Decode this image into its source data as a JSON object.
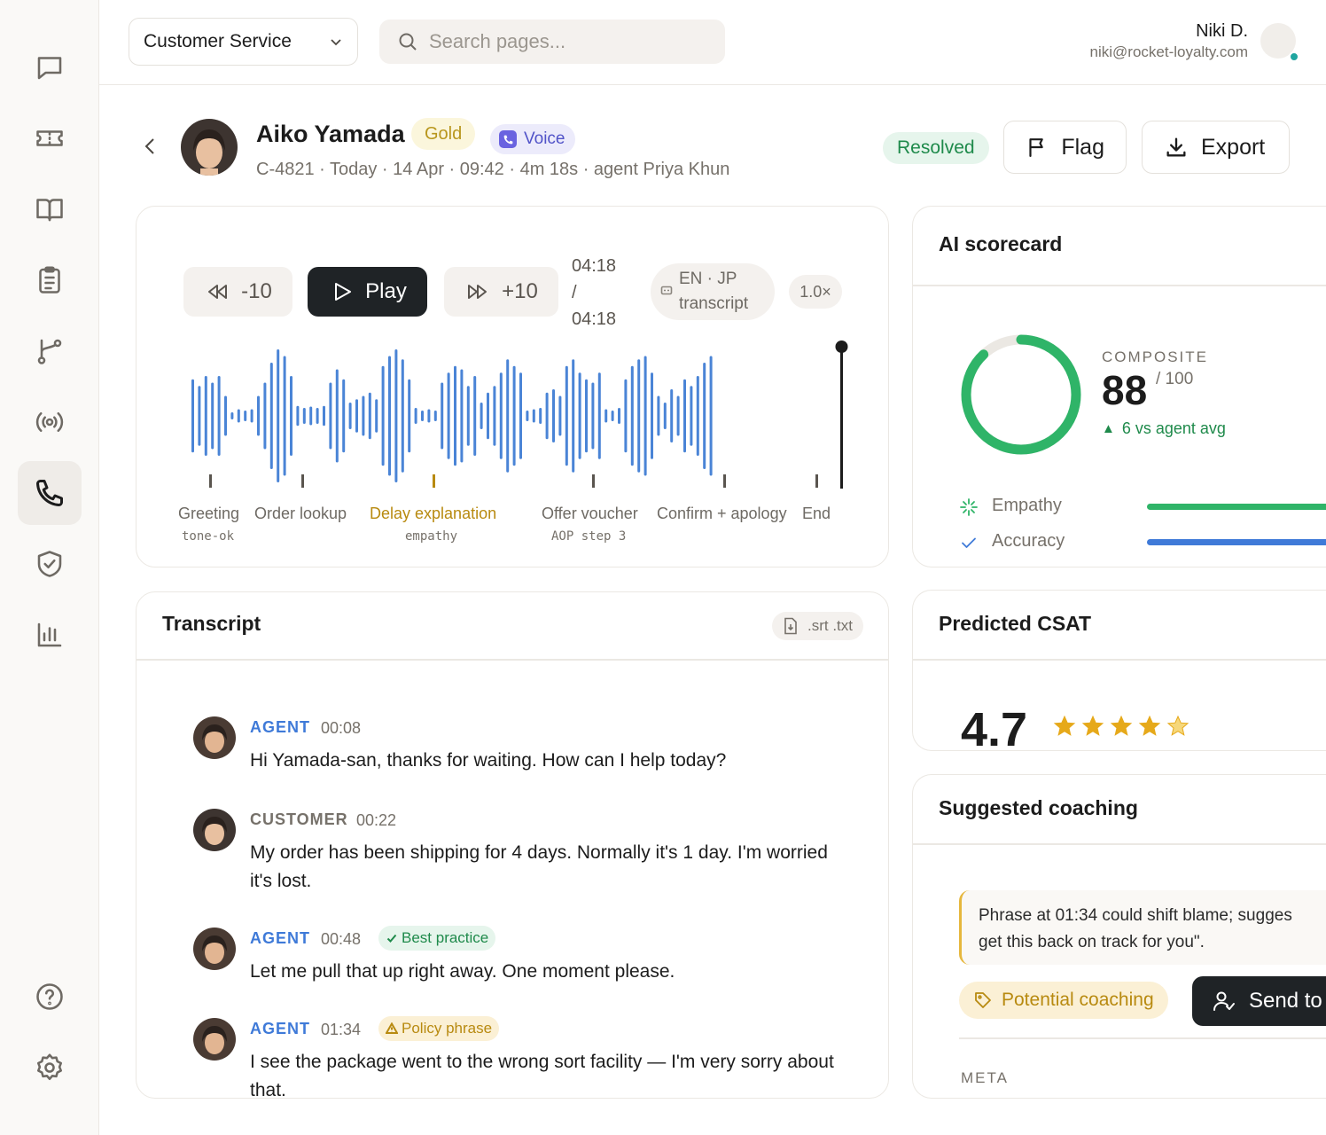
{
  "topbar": {
    "workspace": "Customer Service",
    "search_placeholder": "Search pages...",
    "user_name": "Niki D.",
    "user_email": "niki@rocket-loyalty.com"
  },
  "sidebar": {
    "items": [
      {
        "icon": "message-icon"
      },
      {
        "icon": "ticket-icon"
      },
      {
        "icon": "book-icon"
      },
      {
        "icon": "clipboard-icon"
      },
      {
        "icon": "branch-icon"
      },
      {
        "icon": "broadcast-icon"
      },
      {
        "icon": "phone-icon",
        "active": true
      },
      {
        "icon": "shield-check-icon"
      },
      {
        "icon": "bar-chart-icon"
      },
      {
        "icon": "help-icon"
      },
      {
        "icon": "gear-icon"
      }
    ]
  },
  "header": {
    "customer_name": "Aiko Yamada",
    "tier_badge": "Gold",
    "channel_badge": "Voice",
    "meta": "C-4821 · Today · 14 Apr · 09:42 · 4m 18s · agent Priya Khun",
    "status_badge": "Resolved",
    "flag_label": "Flag",
    "export_label": "Export"
  },
  "player": {
    "rewind_label": "-10",
    "play_label": "Play",
    "forward_label": "+10",
    "time_current": "04:18",
    "time_separator": "/",
    "time_total": "04:18",
    "lang_line1": "EN · JP",
    "lang_line2": "transcript",
    "speed": "1.0×",
    "segments": [
      {
        "label": "Greeting",
        "tag": "tone-ok"
      },
      {
        "label": "Order lookup",
        "tag": ""
      },
      {
        "label": "Delay explanation",
        "tag": "empathy",
        "highlight": true
      },
      {
        "label": "Offer voucher",
        "tag": "AOP step 3"
      },
      {
        "label": "Confirm + apology",
        "tag": ""
      },
      {
        "label": "End",
        "tag": ""
      }
    ]
  },
  "transcript": {
    "title": "Transcript",
    "download_label": ".srt .txt",
    "messages": [
      {
        "speaker": "AGENT",
        "time": "00:08",
        "text": "Hi Yamada-san, thanks for waiting. How can I help today?"
      },
      {
        "speaker": "CUSTOMER",
        "time": "00:22",
        "text": "My order has been shipping for 4 days. Normally it's 1 day. I'm worried it's lost."
      },
      {
        "speaker": "AGENT",
        "time": "00:48",
        "tag": "Best practice",
        "text": "Let me pull that up right away. One moment please."
      },
      {
        "speaker": "AGENT",
        "time": "01:34",
        "tag": "Policy phrase",
        "text": "I see the package went to the wrong sort facility — I'm very sorry about that."
      }
    ]
  },
  "scorecard": {
    "title": "AI scorecard",
    "composite_label": "COMPOSITE",
    "composite_value": "88",
    "composite_max": "/ 100",
    "composite_fraction": 0.88,
    "delta": "6 vs agent avg",
    "metrics": [
      {
        "label": "Empathy",
        "icon": "sparkle-icon",
        "color": "#2fb468"
      },
      {
        "label": "Accuracy",
        "icon": "check-icon",
        "color": "#3f7ad8"
      }
    ]
  },
  "csat": {
    "title": "Predicted CSAT",
    "value": "4.7",
    "rating": 4.7,
    "max_stars": 5
  },
  "coaching": {
    "title": "Suggested coaching",
    "suggestion_line1": "Phrase at 01:34 could shift blame; sugges",
    "suggestion_line2": "get this back on track for you\".",
    "tag_label": "Potential coaching",
    "send_label": "Send to",
    "meta_label": "META"
  },
  "colors": {
    "agent": "#3f7ad8",
    "success": "#1f8a4b",
    "gold": "#b8961d",
    "warning": "#b88a10",
    "waveform": "#4a84d6",
    "ring": "#2fb468",
    "dark_button": "#1f2326"
  }
}
